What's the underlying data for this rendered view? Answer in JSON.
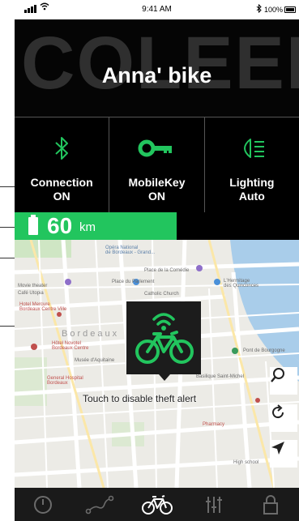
{
  "status_bar": {
    "time": "9:41 AM",
    "battery_percent": "100%",
    "icons": [
      "signal-icon",
      "wifi-icon",
      "bluetooth-icon",
      "battery-icon"
    ]
  },
  "header": {
    "background_word": "COLEEN",
    "title": "Anna' bike"
  },
  "tiles": [
    {
      "icon": "bluetooth-icon",
      "label": "Connection",
      "value": "ON"
    },
    {
      "icon": "key-icon",
      "label": "MobileKey",
      "value": "ON"
    },
    {
      "icon": "headlight-icon",
      "label": "Lighting",
      "value": "Auto"
    }
  ],
  "range": {
    "value": "60",
    "unit": "km",
    "icon": "battery-icon"
  },
  "map": {
    "labels": {
      "opera": "Opéra National\nde Bordeaux - Grand...",
      "place_comedie": "Place de la Comédie",
      "place_parlement": "Place du Parlement",
      "catholic_church": "Catholic Church",
      "hermitage": "L'Hermitage\ndes Quinconces",
      "movie_theater": "Movie theater",
      "pey_berland_cafe": "Café Utopia",
      "hotel_mercure": "Hotel Mercure\nBordeaux Centre Ville",
      "bordeaux": "Bordeaux",
      "novotel": "Hôtel Novotel\nBordeaux Centre",
      "musee": "Musée d'Aquitaine",
      "pont": "Pont de Bourgogne",
      "general_hospital": "General Hospital\nBordeaux",
      "basilique": "Basilique Saint-Michel",
      "pharmacy": "Pharmacy",
      "high_school": "High school"
    },
    "theft_alert_text": "Touch to disable theft alert",
    "buttons": [
      "search-icon",
      "refresh-icon",
      "navigation-arrow-icon"
    ]
  },
  "bottom_nav": {
    "items": [
      "speedometer-icon",
      "route-icon",
      "bicycle-icon",
      "settings-sliders-icon",
      "lock-icon"
    ],
    "active_index": 2
  },
  "colors": {
    "accent": "#22c55e",
    "background": "#000000",
    "water": "#a9cdea"
  }
}
